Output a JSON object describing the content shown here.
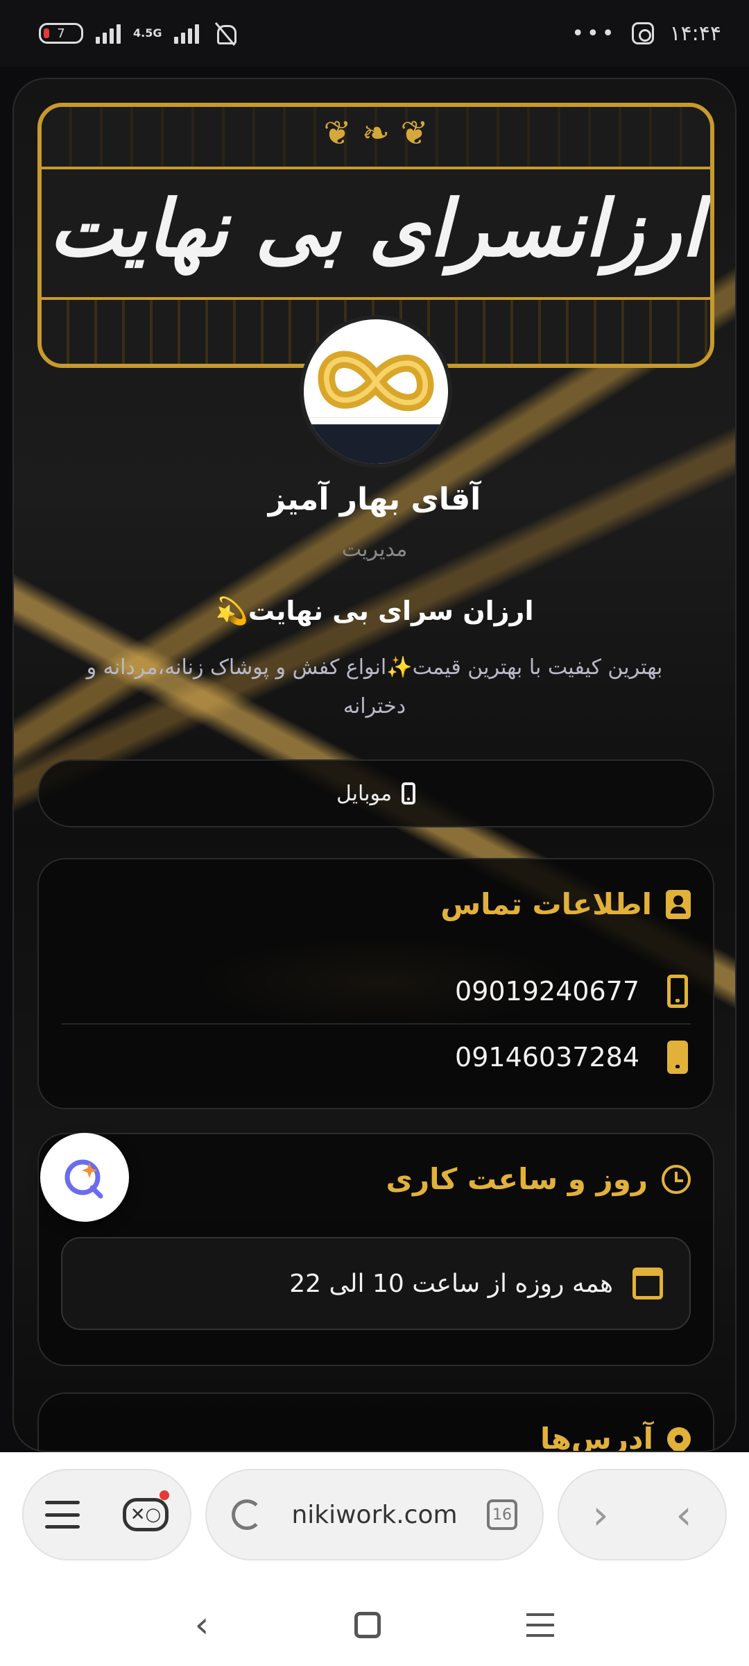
{
  "status_bar": {
    "battery": "7",
    "network": "4.5G",
    "time": "۱۴:۴۴",
    "more": "•••"
  },
  "profile": {
    "banner_text": "ارزانسرای بی نهایت",
    "name": "آقای بهار آمیز",
    "role": "مدیریت",
    "tagline": "ارزان سرای بی نهایت💫",
    "description": "بهترین کیفیت با بهترین قیمت✨انواع کفش و پوشاک زنانه،مردانه و دخترانه",
    "mobile_button": "موبایل"
  },
  "contact": {
    "title": "اطلاعات تماس",
    "phones": [
      "09019240677",
      "09146037284"
    ]
  },
  "hours": {
    "title": "روز و ساعت کاری",
    "text": "همه روزه از ساعت 10 الی 22"
  },
  "addresses": {
    "title": "آدرس‌ها"
  },
  "browser": {
    "url": "nikiwork.com",
    "tab_count": "16"
  },
  "colors": {
    "accent_gold": "#e2b13a",
    "background": "#0c0c0e"
  }
}
